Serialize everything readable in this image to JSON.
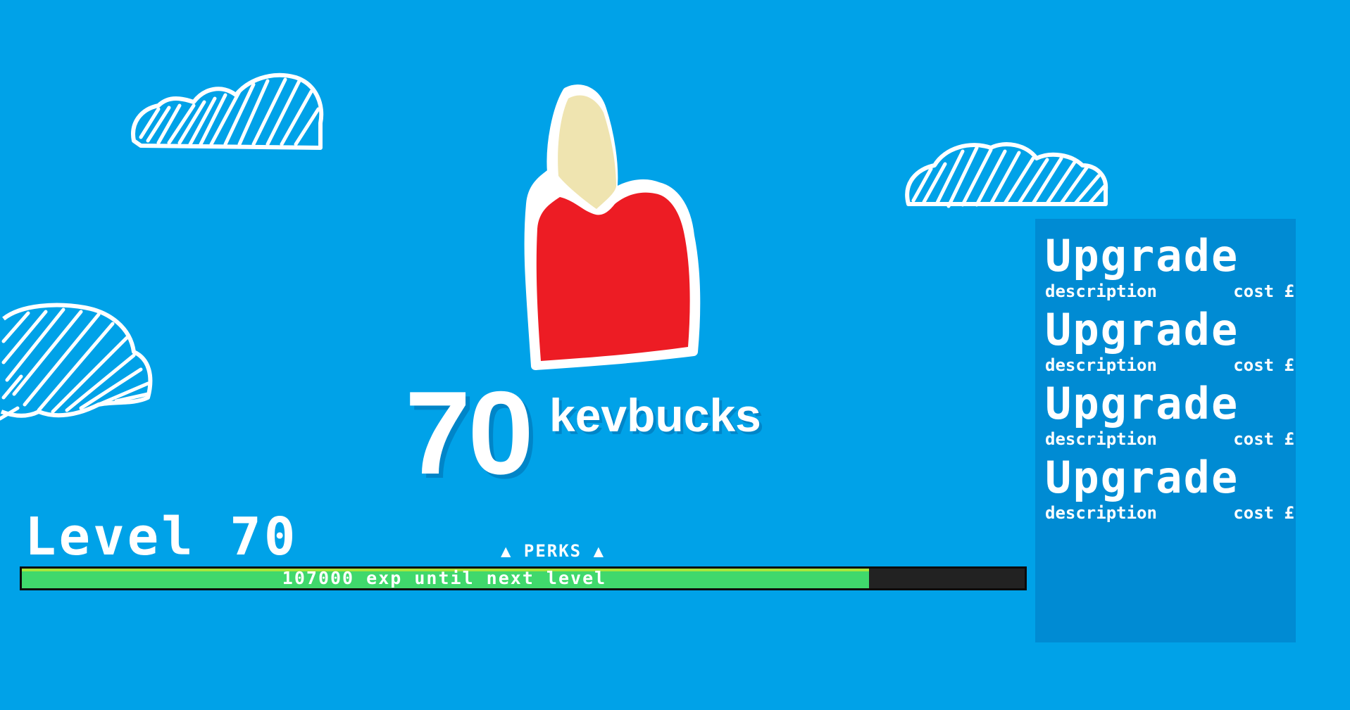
{
  "currency": {
    "amount": "70",
    "unit": "kevbucks"
  },
  "level": {
    "label": "Level 70"
  },
  "perks": {
    "label": "▲ PERKS ▲"
  },
  "exp": {
    "text": "107000 exp until next level",
    "progress": 0.845
  },
  "upgrades": [
    {
      "name": "Upgrade",
      "description": "description",
      "cost": "cost £"
    },
    {
      "name": "Upgrade",
      "description": "description",
      "cost": "cost £"
    },
    {
      "name": "Upgrade",
      "description": "description",
      "cost": "cost £"
    },
    {
      "name": "Upgrade",
      "description": "description",
      "cost": "cost £"
    }
  ],
  "colors": {
    "sky": "#00a2e8",
    "panel": "#008bd3",
    "shirt": "#ed1c24",
    "head": "#efe4b0",
    "exp_fill": "#40d86c",
    "exp_highlight": "#a8e63b",
    "exp_track": "#222222"
  }
}
